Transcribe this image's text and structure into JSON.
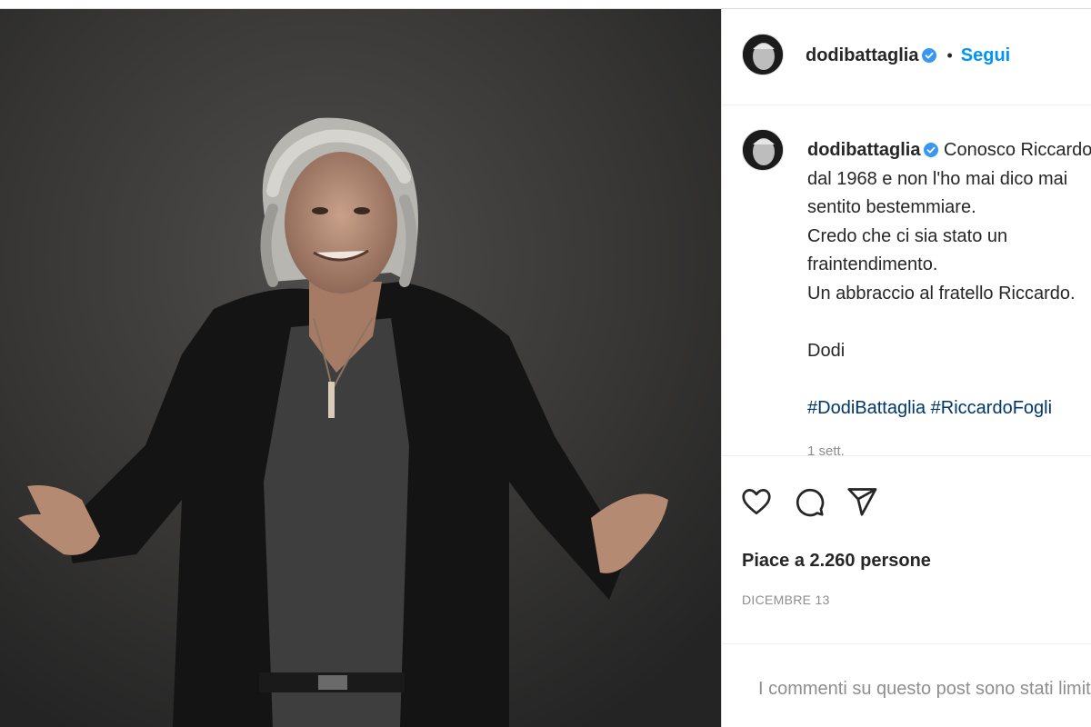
{
  "post": {
    "username": "dodibattaglia",
    "verified": true,
    "follow_label": "Segui",
    "separator": "•",
    "caption_lines": [
      "Conosco Riccardo",
      "dal 1968 e non l'ho mai dico mai",
      "sentito bestemmiare.",
      "Credo che ci sia stato un",
      "fraintendimento.",
      "Un abbraccio al fratello Riccardo.",
      "",
      "Dodi",
      ""
    ],
    "hashtags": [
      "#DodiBattaglia",
      "#RiccardoFogli"
    ],
    "caption_time": "1 sett.",
    "likes_text": "Piace a 2.260 persone",
    "date": "DICEMBRE 13",
    "comments_note": "I commenti su questo post sono stati limitati"
  },
  "icons": {
    "like": "heart-icon",
    "comment": "comment-icon",
    "share": "send-icon",
    "verified": "verified-badge-icon"
  },
  "colors": {
    "link_blue": "#0095f6",
    "hashtag": "#00376b",
    "verified": "#3897f0",
    "muted": "#8e8e8e",
    "text": "#262626"
  }
}
